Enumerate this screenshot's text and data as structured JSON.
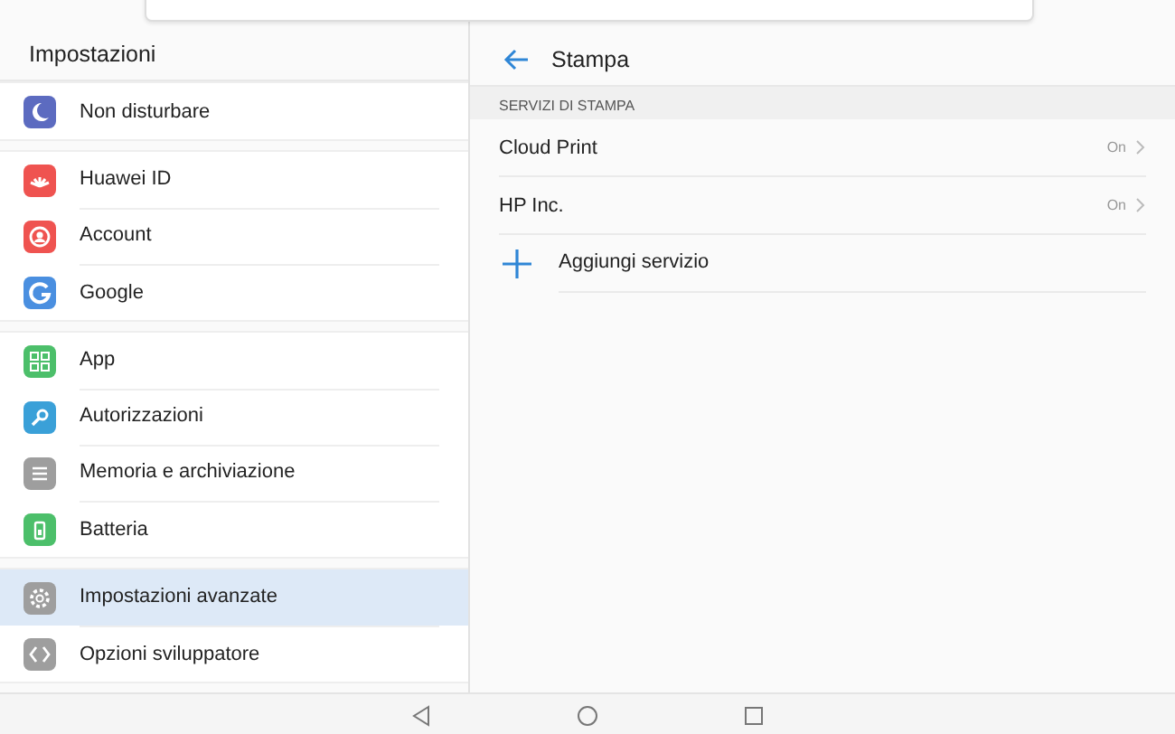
{
  "sidebar": {
    "title": "Impostazioni",
    "groups": [
      {
        "items": [
          {
            "label": "Non disturbare",
            "selected": false
          }
        ]
      },
      {
        "items": [
          {
            "label": "Huawei ID",
            "selected": false
          },
          {
            "label": "Account",
            "selected": false
          },
          {
            "label": "Google",
            "selected": false
          }
        ]
      },
      {
        "items": [
          {
            "label": "App",
            "selected": false
          },
          {
            "label": "Autorizzazioni",
            "selected": false
          },
          {
            "label": "Memoria e archiviazione",
            "selected": false
          },
          {
            "label": "Batteria",
            "selected": false
          }
        ]
      },
      {
        "items": [
          {
            "label": "Impostazioni avanzate",
            "selected": true
          },
          {
            "label": "Opzioni sviluppatore",
            "selected": false
          }
        ]
      }
    ]
  },
  "detail": {
    "title": "Stampa",
    "section": "SERVIZI DI STAMPA",
    "services": [
      {
        "name": "Cloud Print",
        "status": "On"
      },
      {
        "name": "HP Inc.",
        "status": "On"
      }
    ],
    "add_label": "Aggiungi servizio"
  }
}
